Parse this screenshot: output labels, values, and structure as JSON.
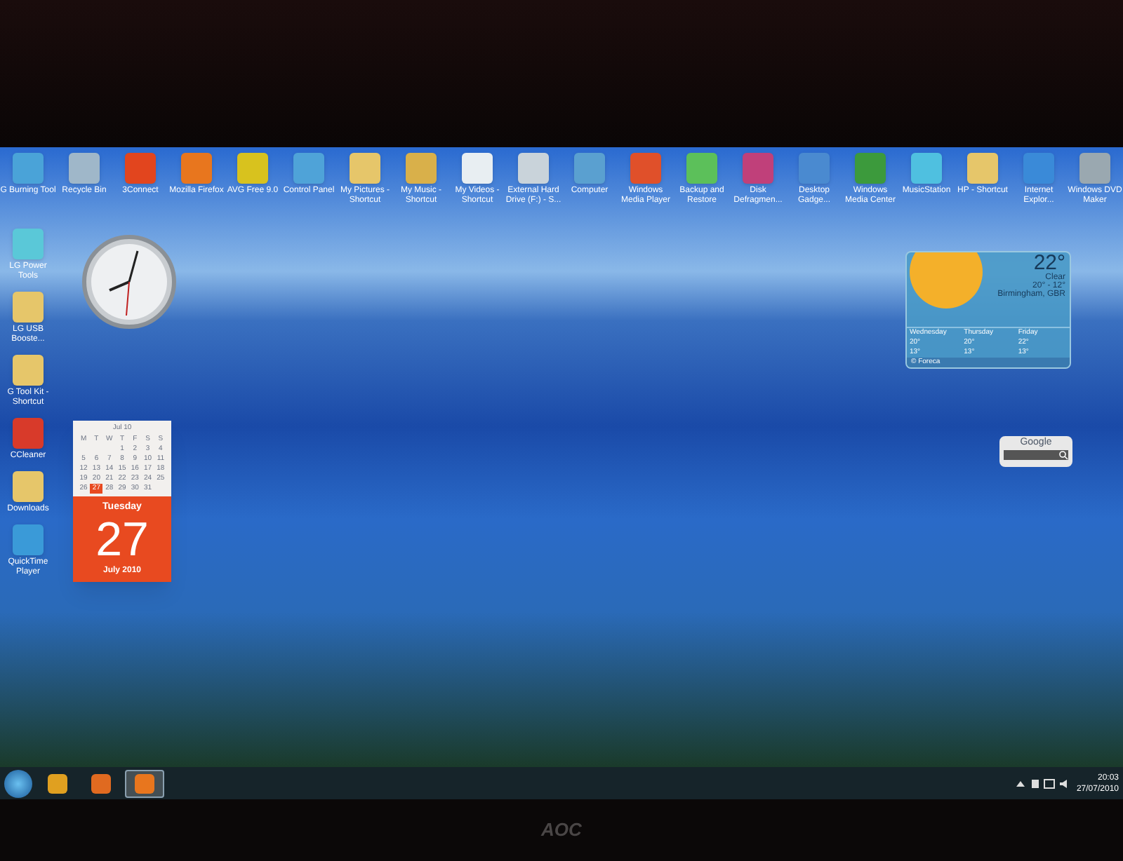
{
  "desktop": {
    "top_icons": [
      {
        "label": "G Burning Tool",
        "color": "#4aa3d8"
      },
      {
        "label": "Recycle Bin",
        "color": "#9fb7c9"
      },
      {
        "label": "3Connect",
        "color": "#e2451e"
      },
      {
        "label": "Mozilla Firefox",
        "color": "#e8761e"
      },
      {
        "label": "AVG Free 9.0",
        "color": "#d8c21e"
      },
      {
        "label": "Control Panel",
        "color": "#4fa3d8"
      },
      {
        "label": "My Pictures - Shortcut",
        "color": "#e6c66a"
      },
      {
        "label": "My Music - Shortcut",
        "color": "#d9b04a"
      },
      {
        "label": "My Videos - Shortcut",
        "color": "#e8eef2"
      },
      {
        "label": "External Hard Drive (F:) - S...",
        "color": "#c9d3da"
      },
      {
        "label": "Computer",
        "color": "#5aa0d0"
      },
      {
        "label": "Windows Media Player",
        "color": "#e0502a"
      },
      {
        "label": "Backup and Restore",
        "color": "#5cc05a"
      },
      {
        "label": "Disk Defragmen...",
        "color": "#c0407a"
      },
      {
        "label": "Desktop Gadge...",
        "color": "#4a8ad0"
      },
      {
        "label": "Windows Media Center",
        "color": "#3c9a3c"
      },
      {
        "label": "MusicStation",
        "color": "#4fc0e0"
      },
      {
        "label": "HP - Shortcut",
        "color": "#e6c66a"
      },
      {
        "label": "Internet Explor...",
        "color": "#3a8ad8"
      },
      {
        "label": "Windows DVD Maker",
        "color": "#9aa8b0"
      }
    ],
    "left_icons": [
      {
        "label": "LG Power Tools",
        "color": "#5ac8d8"
      },
      {
        "label": "LG USB Booste...",
        "color": "#e6c66a"
      },
      {
        "label": "G Tool Kit - Shortcut",
        "color": "#e6c66a"
      },
      {
        "label": "CCleaner",
        "color": "#d83a2a"
      },
      {
        "label": "Downloads",
        "color": "#e6c66a"
      },
      {
        "label": "QuickTime Player",
        "color": "#3a9ad8"
      }
    ]
  },
  "calendar": {
    "month": "Jul 10",
    "weekdays": [
      "M",
      "T",
      "W",
      "T",
      "F",
      "S",
      "S"
    ],
    "weeks": [
      [
        {
          "day": "1",
          "selected": false
        },
        {
          "day": "2",
          "selected": false
        },
        {
          "day": "3",
          "selected": false
        },
        {
          "day": "4",
          "selected": false
        }
      ],
      [
        {
          "day": "5",
          "selected": false
        },
        {
          "day": "6",
          "selected": false
        },
        {
          "day": "7",
          "selected": false
        },
        {
          "day": "8",
          "selected": false
        },
        {
          "day": "9",
          "selected": false
        },
        {
          "day": "10",
          "selected": false
        },
        {
          "day": "11",
          "selected": false
        }
      ],
      [
        {
          "day": "12",
          "selected": false
        },
        {
          "day": "13",
          "selected": false
        },
        {
          "day": "14",
          "selected": false
        },
        {
          "day": "15",
          "selected": false
        },
        {
          "day": "16",
          "selected": false
        },
        {
          "day": "17",
          "selected": false
        },
        {
          "day": "18",
          "selected": false
        }
      ],
      [
        {
          "day": "19",
          "selected": false
        },
        {
          "day": "20",
          "selected": false
        },
        {
          "day": "21",
          "selected": false
        },
        {
          "day": "22",
          "selected": false
        },
        {
          "day": "23",
          "selected": false
        },
        {
          "day": "24",
          "selected": false
        },
        {
          "day": "25",
          "selected": false
        }
      ],
      [
        {
          "day": "26",
          "selected": false
        },
        {
          "day": "27",
          "selected": true
        },
        {
          "day": "28",
          "selected": false
        },
        {
          "day": "29",
          "selected": false
        },
        {
          "day": "30",
          "selected": false
        },
        {
          "day": "31",
          "selected": false
        }
      ]
    ],
    "weekday": "Tuesday",
    "date": "27",
    "month_year": "July 2010"
  },
  "weather": {
    "temperature": "22°",
    "condition": "Clear",
    "range": "20° - 12°",
    "location": "Birmingham, GBR",
    "forecast": [
      {
        "day": "Wednesday",
        "high": "20°",
        "low": "13°"
      },
      {
        "day": "Thursday",
        "high": "20°",
        "low": "13°"
      },
      {
        "day": "Friday",
        "high": "22°",
        "low": "13°"
      }
    ],
    "source": "© Foreca"
  },
  "search_gadget": {
    "title": "Google"
  },
  "taskbar": {
    "pinned": [
      {
        "color": "#e0a020",
        "selected": false
      },
      {
        "color": "#e06a20",
        "selected": false
      },
      {
        "color": "#e8761e",
        "selected": true
      }
    ],
    "time": "20:03",
    "date": "27/07/2010"
  },
  "monitor": {
    "brand": "AOC"
  }
}
